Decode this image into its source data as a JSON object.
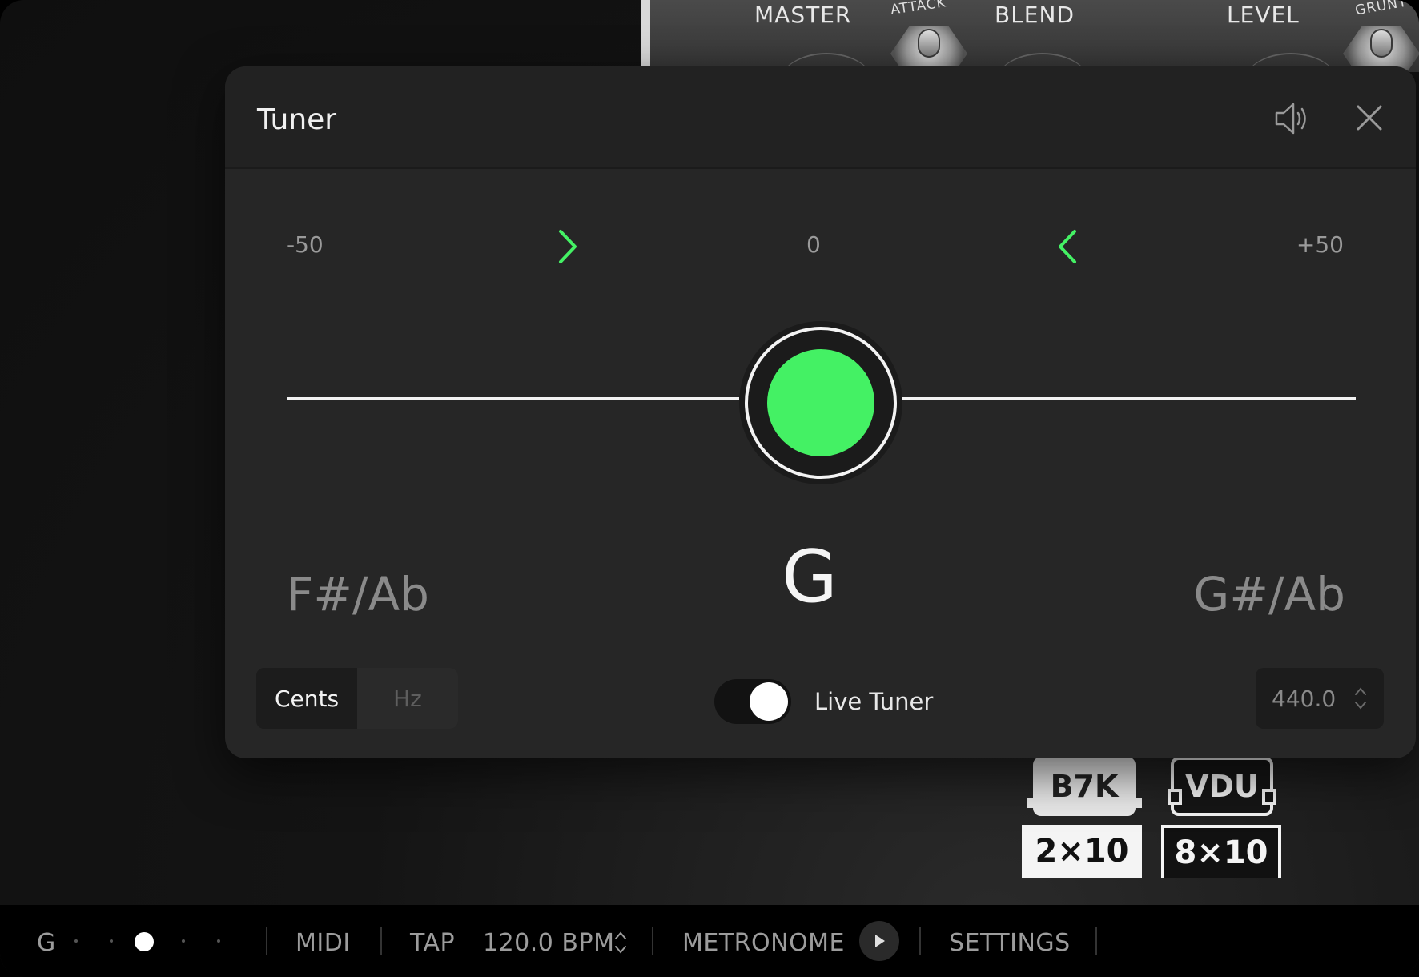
{
  "amp": {
    "labels": [
      "MASTER",
      "BLEND",
      "LEVEL"
    ],
    "small_labels": [
      "ATTACK",
      "GRUNT"
    ]
  },
  "cabinets": [
    {
      "head": "B7K",
      "size": "2×10"
    },
    {
      "head": "VDU",
      "size": "8×10"
    }
  ],
  "tuner": {
    "title": "Tuner",
    "scale": {
      "min": "-50",
      "center": "0",
      "max": "+50"
    },
    "deviation_cents": 0,
    "indicator_color": "#44f164",
    "notes": {
      "flat": "F#/Ab",
      "current": "G",
      "sharp": "G#/Ab"
    },
    "units": {
      "options": [
        "Cents",
        "Hz"
      ],
      "selected": "Cents"
    },
    "live_tuner": {
      "label": "Live Tuner",
      "enabled": true
    },
    "reference_pitch": "440.0"
  },
  "bottom_bar": {
    "tuner_note": "G",
    "midi": "MIDI",
    "tap": "TAP",
    "bpm": "120.0 BPM",
    "metronome": "METRONOME",
    "settings": "SETTINGS"
  }
}
